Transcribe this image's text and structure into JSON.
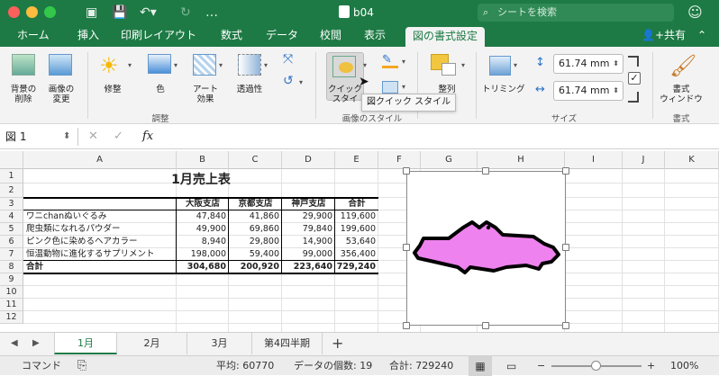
{
  "title_bar": {
    "doc_title": "b04",
    "search_placeholder": "シートを検索"
  },
  "tabs": [
    "ホーム",
    "挿入",
    "印刷レイアウト",
    "数式",
    "データ",
    "校閲",
    "表示",
    "図の書式設定"
  ],
  "share_label": "共有",
  "ribbon": {
    "remove_bg": [
      "背景の",
      "削除"
    ],
    "change_picture": [
      "画像の",
      "変更"
    ],
    "corrections": "修整",
    "color": "色",
    "artistic_effects": [
      "アート",
      "効果"
    ],
    "transparency": "透過性",
    "adjust_group": "調整",
    "quick_styles": [
      "クイック",
      "スタイ"
    ],
    "picture_styles_group": "画像のスタイル",
    "arrange": "整列",
    "crop": "トリミング",
    "height_value": "61.74 mm",
    "width_value": "61.74 mm",
    "size_group": "サイズ",
    "format_pane": [
      "書式",
      "ウィンドウ"
    ],
    "format_group": "書式",
    "tooltip": "図クイック スタイル"
  },
  "formula_bar": {
    "name_box": "図 1",
    "fx": "fx"
  },
  "columns": [
    "A",
    "B",
    "C",
    "D",
    "E",
    "F",
    "G",
    "H",
    "I",
    "J",
    "K"
  ],
  "rows": [
    "1",
    "2",
    "3",
    "4",
    "5",
    "6",
    "7",
    "8",
    "9",
    "10",
    "11",
    "12"
  ],
  "sheet": {
    "title": "1月売上表",
    "headers": [
      "大阪支店",
      "京都支店",
      "神戸支店",
      "合計"
    ],
    "data": [
      [
        "ワニchanぬいぐるみ",
        "47,840",
        "41,860",
        "29,900",
        "119,600"
      ],
      [
        "爬虫類になれるパウダー",
        "49,900",
        "69,860",
        "79,840",
        "199,600"
      ],
      [
        "ピンク色に染めるヘアカラー",
        "8,940",
        "29,800",
        "14,900",
        "53,640"
      ],
      [
        "恒温動物に進化するサプリメント",
        "198,000",
        "59,400",
        "99,000",
        "356,400"
      ],
      [
        "合計",
        "304,680",
        "200,920",
        "223,640",
        "729,240"
      ]
    ]
  },
  "sheet_tabs": [
    "1月",
    "2月",
    "3月",
    "第4四半期"
  ],
  "status": {
    "mode": "コマンド",
    "average": "平均: 60770",
    "count": "データの個数: 19",
    "sum": "合計: 729240",
    "zoom": "100%"
  },
  "colors": {
    "accent": "#1d7a44",
    "crocodile": "#ee82ee"
  }
}
